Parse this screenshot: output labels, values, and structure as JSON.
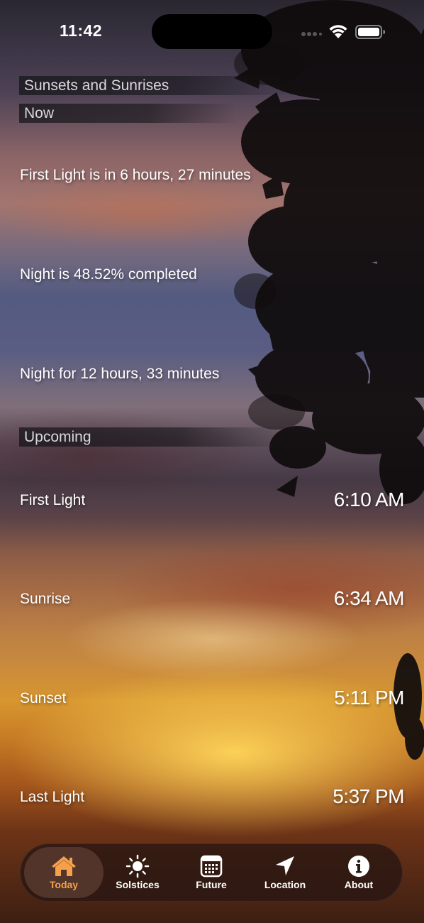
{
  "status_bar": {
    "time": "11:42"
  },
  "app": {
    "title": "Sunsets and Sunrises"
  },
  "now": {
    "header": "Now",
    "items": [
      "First Light is in 6 hours, 27 minutes",
      "Night is 48.52% completed",
      "Night for 12 hours, 33 minutes"
    ]
  },
  "upcoming": {
    "header": "Upcoming",
    "events": [
      {
        "label": "First Light",
        "time": "6:10 AM"
      },
      {
        "label": "Sunrise",
        "time": "6:34 AM"
      },
      {
        "label": "Sunset",
        "time": "5:11 PM"
      },
      {
        "label": "Last Light",
        "time": "5:37 PM"
      }
    ]
  },
  "tab_bar": {
    "selected": "Today",
    "tabs": [
      {
        "label": "Today",
        "icon": "house-icon"
      },
      {
        "label": "Solstices",
        "icon": "sun-icon"
      },
      {
        "label": "Future",
        "icon": "calendar-icon"
      },
      {
        "label": "Location",
        "icon": "location-arrow-icon"
      },
      {
        "label": "About",
        "icon": "info-icon"
      }
    ]
  },
  "colors": {
    "accent": "#f5a04a",
    "tab_bar_bg": "#28160f"
  }
}
